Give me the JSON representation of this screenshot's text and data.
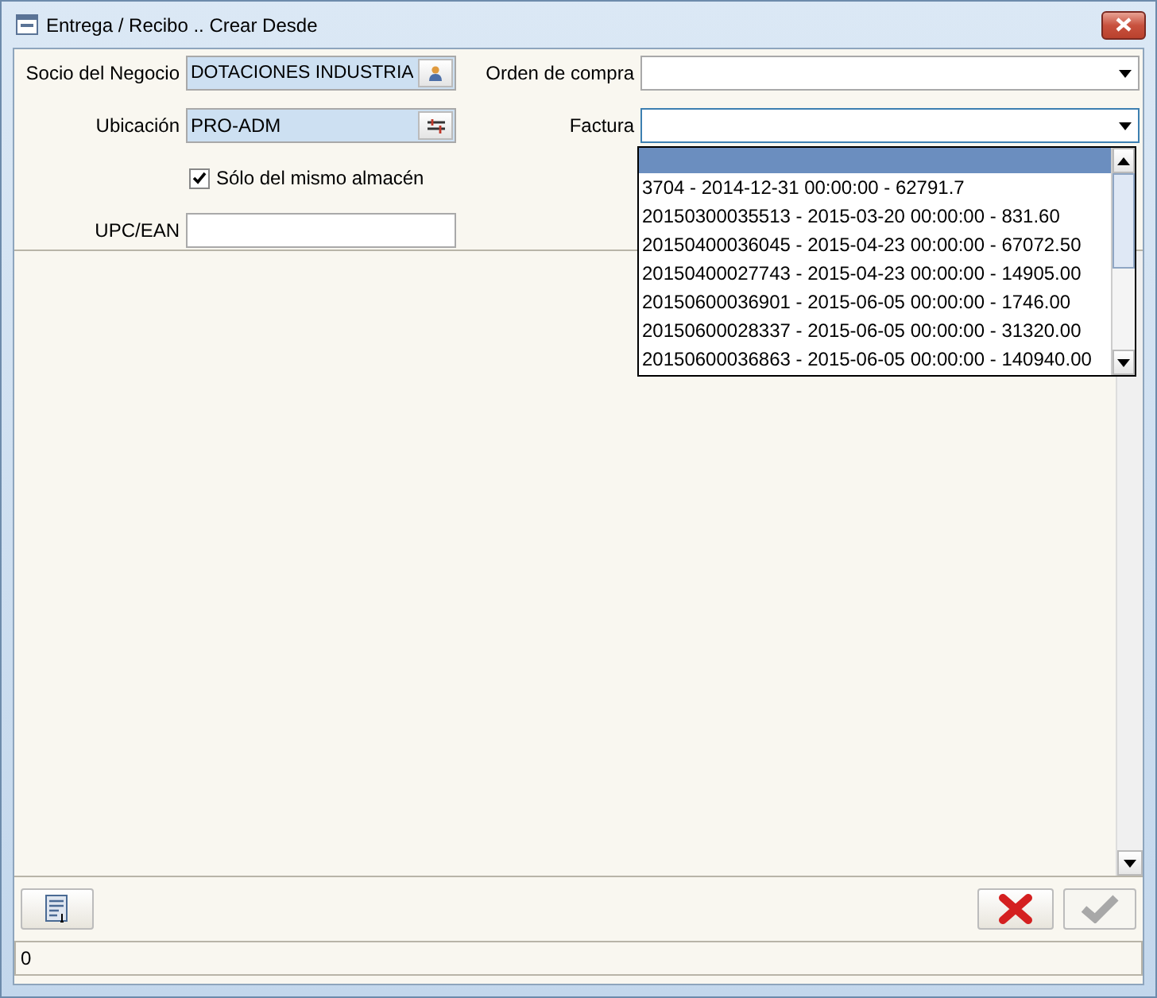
{
  "window": {
    "title": "Entrega / Recibo .. Crear Desde"
  },
  "form": {
    "business_partner": {
      "label": "Socio del Negocio",
      "value": "DOTACIONES INDUSTRIA"
    },
    "purchase_order": {
      "label": "Orden de compra"
    },
    "location": {
      "label": "Ubicación",
      "value": "PRO-ADM"
    },
    "invoice": {
      "label": "Factura",
      "expanded": true,
      "blank_row_selected": true,
      "options": [
        {
          "text": "3704 - 2014-12-31 00:00:00 - 62791.7",
          "selected": false
        },
        {
          "text": "20150300035513 - 2015-03-20 00:00:00 - 831.60",
          "selected": false
        },
        {
          "text": "20150400036045 - 2015-04-23 00:00:00 - 67072.50",
          "selected": false
        },
        {
          "text": "20150400027743 - 2015-04-23 00:00:00 - 14905.00",
          "selected": false
        },
        {
          "text": "20150600036901 - 2015-06-05 00:00:00 - 1746.00",
          "selected": false
        },
        {
          "text": "20150600028337 - 2015-06-05 00:00:00 - 31320.00",
          "selected": false
        },
        {
          "text": "20150600036863 - 2015-06-05 00:00:00 - 140940.00",
          "selected": false
        }
      ]
    },
    "same_warehouse": {
      "label": "Sólo del mismo almacén",
      "checked": true
    },
    "upc": {
      "label": "UPC/EAN"
    }
  },
  "buttons": {
    "cancel": {
      "disabled": false
    },
    "ok": {
      "disabled": true
    }
  },
  "status_bar": {
    "text": "0"
  }
}
